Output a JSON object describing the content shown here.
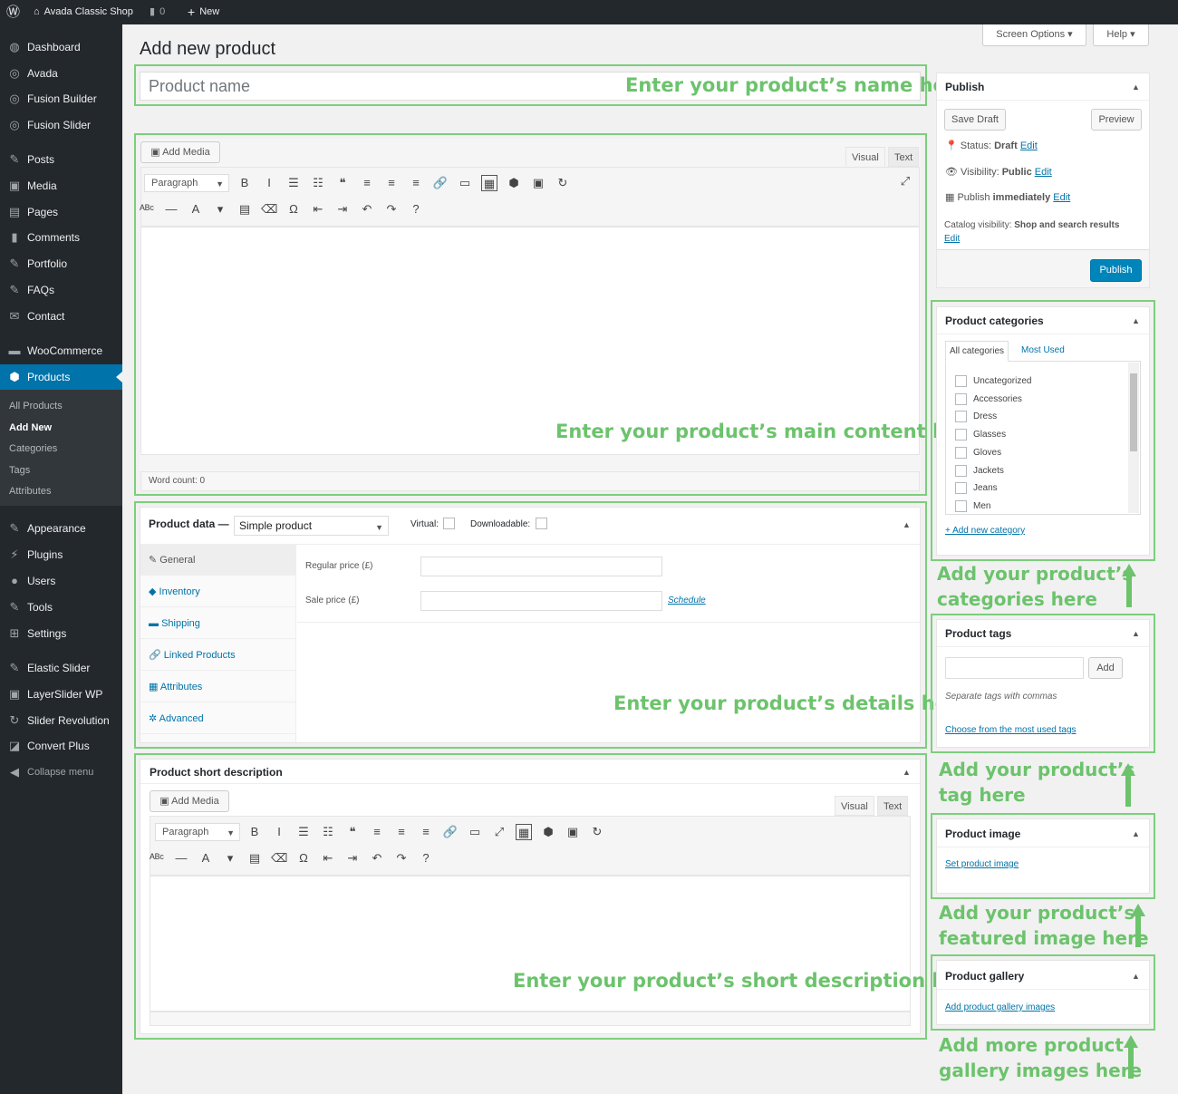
{
  "adminbar": {
    "site_name": "Avada Classic Shop",
    "comments_count": "0",
    "new_label": "New"
  },
  "sidebar": {
    "items": [
      {
        "label": "Dashboard",
        "icon": "dashboard-icon"
      },
      {
        "label": "Avada",
        "icon": "avada-icon"
      },
      {
        "label": "Fusion Builder",
        "icon": "fusion-builder-icon"
      },
      {
        "label": "Fusion Slider",
        "icon": "fusion-slider-icon"
      },
      {
        "label": "Posts",
        "icon": "pin-icon"
      },
      {
        "label": "Media",
        "icon": "media-icon"
      },
      {
        "label": "Pages",
        "icon": "pages-icon"
      },
      {
        "label": "Comments",
        "icon": "comments-icon"
      },
      {
        "label": "Portfolio",
        "icon": "pin-icon"
      },
      {
        "label": "FAQs",
        "icon": "pin-icon"
      },
      {
        "label": "Contact",
        "icon": "mail-icon"
      },
      {
        "label": "WooCommerce",
        "icon": "woocommerce-icon"
      },
      {
        "label": "Products",
        "icon": "products-icon"
      },
      {
        "label": "Appearance",
        "icon": "appearance-icon"
      },
      {
        "label": "Plugins",
        "icon": "plugins-icon"
      },
      {
        "label": "Users",
        "icon": "users-icon"
      },
      {
        "label": "Tools",
        "icon": "tools-icon"
      },
      {
        "label": "Settings",
        "icon": "settings-icon"
      },
      {
        "label": "Elastic Slider",
        "icon": "pin-icon"
      },
      {
        "label": "LayerSlider WP",
        "icon": "layerslider-icon"
      },
      {
        "label": "Slider Revolution",
        "icon": "refresh-icon"
      },
      {
        "label": "Convert Plus",
        "icon": "convert-plus-icon"
      },
      {
        "label": "Collapse menu",
        "icon": "collapse-icon"
      }
    ],
    "submenu": [
      "All Products",
      "Add New",
      "Categories",
      "Tags",
      "Attributes"
    ]
  },
  "page": {
    "title": "Add new product",
    "screen_options": "Screen Options",
    "help": "Help"
  },
  "title_field": {
    "placeholder": "Product name"
  },
  "editor": {
    "add_media": "Add Media",
    "tab_visual": "Visual",
    "tab_text": "Text",
    "format": "Paragraph",
    "word_count": "Word count: 0"
  },
  "product_data": {
    "label": "Product data —",
    "type": "Simple product",
    "virtual": "Virtual:",
    "downloadable": "Downloadable:",
    "tabs": [
      "General",
      "Inventory",
      "Shipping",
      "Linked Products",
      "Attributes",
      "Advanced"
    ],
    "regular_price": "Regular price (£)",
    "sale_price": "Sale price (£)",
    "schedule": "Schedule"
  },
  "short_desc": {
    "title": "Product short description",
    "add_media": "Add Media",
    "tab_visual": "Visual",
    "tab_text": "Text",
    "format": "Paragraph"
  },
  "publish": {
    "title": "Publish",
    "save_draft": "Save Draft",
    "preview": "Preview",
    "status_label": "Status:",
    "status_value": "Draft",
    "visibility_label": "Visibility:",
    "visibility_value": "Public",
    "publish_label": "Publish",
    "publish_value": "immediately",
    "edit": "Edit",
    "catalog_label": "Catalog visibility:",
    "catalog_value": "Shop and search results",
    "publish_button": "Publish"
  },
  "categories": {
    "title": "Product categories",
    "tab_all": "All categories",
    "tab_most": "Most Used",
    "items": [
      "Uncategorized",
      "Accessories",
      "Dress",
      "Glasses",
      "Gloves",
      "Jackets",
      "Jeans",
      "Men"
    ],
    "add_new": "+ Add new category"
  },
  "tags": {
    "title": "Product tags",
    "add": "Add",
    "hint": "Separate tags with commas",
    "choose": "Choose from the most used tags"
  },
  "image": {
    "title": "Product image",
    "set": "Set product image"
  },
  "gallery": {
    "title": "Product gallery",
    "add": "Add product gallery images"
  },
  "annotations": {
    "name": "Enter your product’s name here",
    "content": "Enter your product’s main content here",
    "details": "Enter your product’s details here",
    "short": "Enter your product’s short description here",
    "categories": [
      "Add your product’s",
      "categories here"
    ],
    "tags": [
      "Add your product’s",
      "tag here"
    ],
    "image": [
      "Add your product’s",
      "featured image here"
    ],
    "gallery": [
      "Add more product",
      "gallery images here"
    ]
  },
  "colors": {
    "accent": "#0073aa",
    "annotation": "#6cc36c",
    "sidebar": "#23282d"
  }
}
